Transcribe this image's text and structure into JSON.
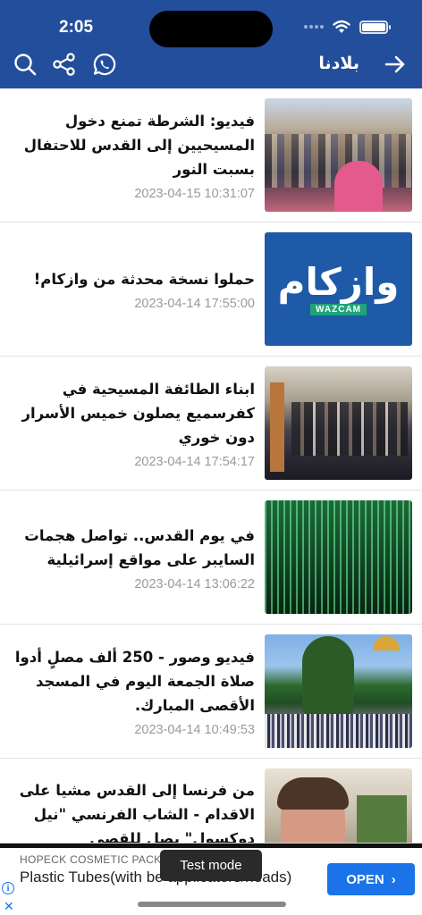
{
  "status_bar": {
    "time": "2:05"
  },
  "header": {
    "title": "بلادنا"
  },
  "icons": {
    "search": "search-icon",
    "share": "share-icon",
    "whatsapp": "whatsapp-icon",
    "back": "arrow-right-icon",
    "wifi": "wifi-icon",
    "battery": "battery-icon"
  },
  "colors": {
    "header_bg": "#234e9b",
    "ad_button": "#1a73e8",
    "date_text": "#9a9a9a"
  },
  "news": [
    {
      "headline": "فيديو: الشرطة  تمنع دخول المسيحيين إلى القدس للاحتفال بسبت النور",
      "date": "2023-04-15 10:31:07"
    },
    {
      "headline": "حملوا نسخة محدثة من وازكام!",
      "date": "2023-04-14 17:55:00",
      "thumb_logo_ar": "وازكام",
      "thumb_logo_en": "WAZCAM"
    },
    {
      "headline": "ابناء الطائفة المسيحية في كفرسميع يصلون خميس الأسرار  دون خوري",
      "date": "2023-04-14 17:54:17"
    },
    {
      "headline": "في يوم القدس..  تواصل هجمات السايبر على مواقع إسرائيلية",
      "date": "2023-04-14 13:06:22"
    },
    {
      "headline": "فيديو وصور - 250 ألف مصلٍ أدوا صلاة الجمعة اليوم في المسجد الأقصى المبارك.",
      "date": "2023-04-14 10:49:53"
    },
    {
      "headline": "من فرنسا إلى القدس مشيا على الاقدام -  الشاب الفرنسي \"نيل دوكسول\" يصل للقصى",
      "date": ""
    }
  ],
  "ad": {
    "company": "HOPECK COSMETIC PACKA",
    "title": "Plastic Tubes(with                          be applicators/heads)",
    "button": "OPEN",
    "close": "✕",
    "info": "i"
  },
  "toast": "Test mode"
}
